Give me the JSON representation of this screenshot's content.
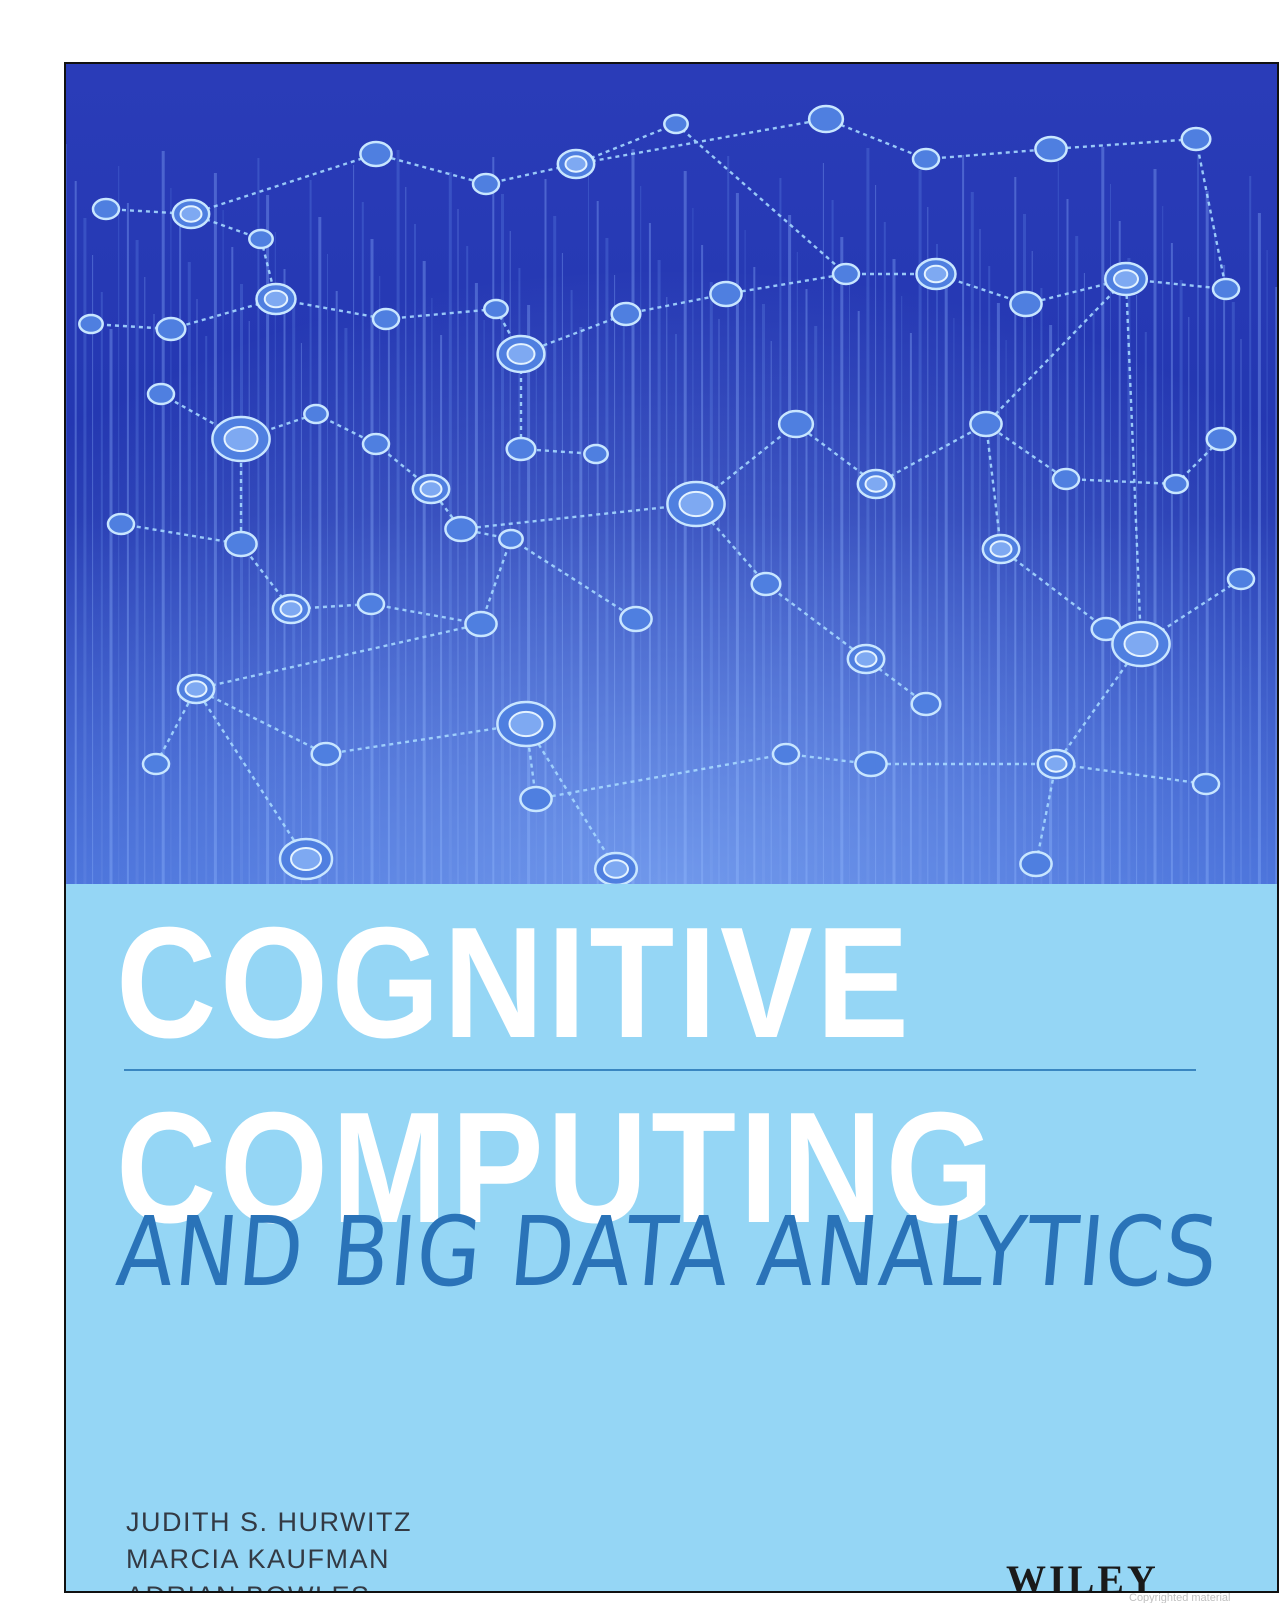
{
  "cover": {
    "title_line_1": "COGNITIVE",
    "title_line_2": "COMPUTING",
    "subtitle": "AND BIG DATA ANALYTICS",
    "authors": [
      "JUDITH S. HURWITZ",
      "MARCIA KAUFMAN",
      "ADRIAN BOWLES"
    ],
    "publisher": "WILEY",
    "copyright_notice": "Copyrighted material"
  },
  "colors": {
    "lower_panel": "#95d6f5",
    "art_base": "#1c2fa8",
    "node_line": "#a6d8ff",
    "subtitle": "#2a73b8",
    "title": "#ffffff"
  }
}
